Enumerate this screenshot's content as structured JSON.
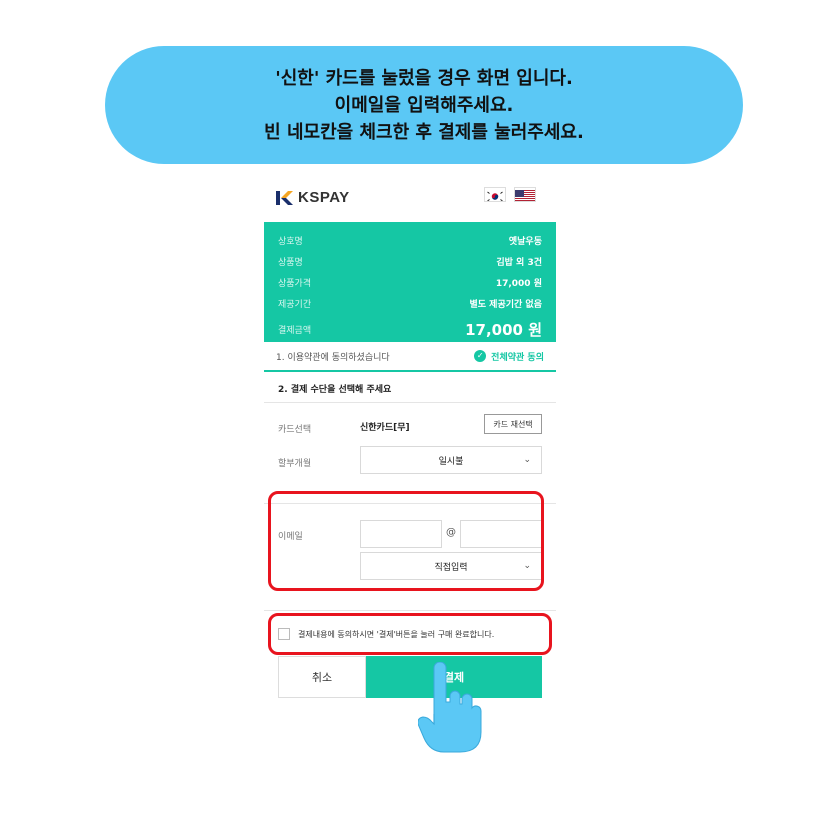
{
  "instruction": {
    "lines": [
      "'신한' 카드를 눌렀을 경우 화면 입니다.",
      "이메일을 입력해주세요.",
      "빈 네모칸을 체크한 후 결제를 눌러주세요."
    ],
    "bg_color": "#5bc8f5"
  },
  "header": {
    "logo_text": "KSPAY",
    "flags": [
      "korea-flag-icon",
      "usa-flag-icon"
    ]
  },
  "summary": {
    "bg_color": "#15c7a4",
    "rows": [
      {
        "label": "상호명",
        "value": "옛날우동"
      },
      {
        "label": "상품명",
        "value": "김밥 외 3건"
      },
      {
        "label": "상품가격",
        "value": "17,000 원"
      },
      {
        "label": "제공기간",
        "value": "별도 제공기간 없음"
      }
    ],
    "total": {
      "label": "결제금액",
      "value": "17,000 원"
    }
  },
  "terms_agree": {
    "text": "1. 이용약관에 동의하셨습니다",
    "all_label": "전체약관 동의"
  },
  "payment": {
    "section_title": "2. 결제 수단을 선택해 주세요",
    "card_label": "카드선택",
    "card_name": "신한카드[무]",
    "reselect_label": "카드 재선택",
    "installment_label": "할부개월",
    "installment_value": "일시불"
  },
  "email": {
    "label": "이메일",
    "at": "@",
    "domain_select": "직접입력"
  },
  "final_terms": "결제내용에 동의하시면 '결제'버튼을 눌러 구매 완료합니다.",
  "buttons": {
    "cancel": "취소",
    "pay": "결제"
  },
  "highlight_color": "#e8141e"
}
